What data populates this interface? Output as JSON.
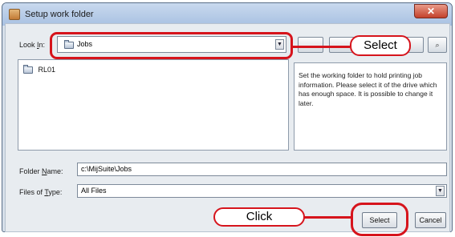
{
  "window": {
    "title": "Setup work folder",
    "close_glyph": "✕"
  },
  "look_in": {
    "label_pre": "Look ",
    "label_key": "I",
    "label_post": "n:",
    "value": "Jobs"
  },
  "toolbar": {
    "btn1": "",
    "btn2": "",
    "btn3": "",
    "search_glyph": "⌕"
  },
  "file_list": {
    "items": [
      "RL01"
    ]
  },
  "description": "Set the working folder to hold printing job information. Please select it of the drive which has enough space. It is possible to change it later.",
  "folder_name": {
    "label_pre": "Folder ",
    "label_key": "N",
    "label_post": "ame:",
    "value": "c:\\MijSuite\\Jobs"
  },
  "files_of_type": {
    "label_pre": "Files of ",
    "label_key": "T",
    "label_post": "ype:",
    "value": "All Files"
  },
  "buttons": {
    "select": "Select",
    "cancel": "Cancel"
  },
  "callouts": {
    "top": "Select",
    "bottom": "Click"
  },
  "colors": {
    "highlight": "#d6141c",
    "window_bg": "#d6dfe9"
  }
}
